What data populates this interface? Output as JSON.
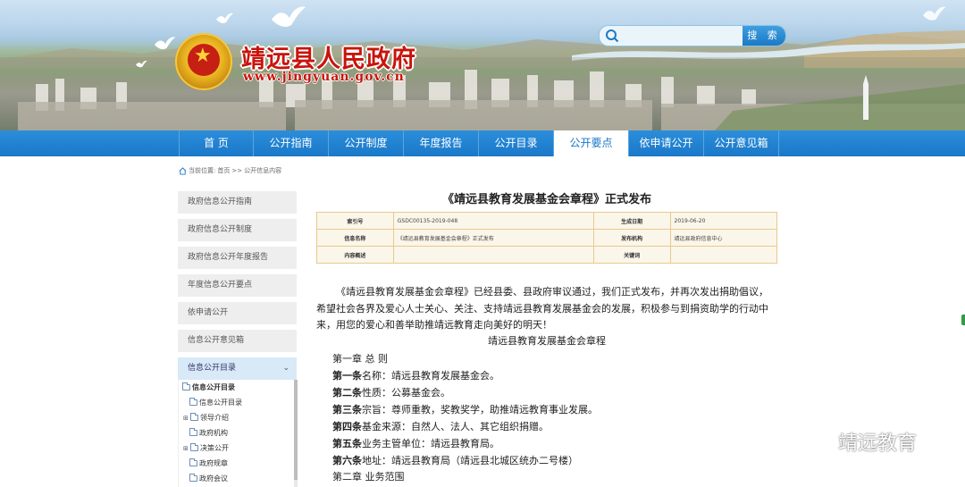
{
  "header": {
    "site_title": "靖远县人民政府",
    "site_url": "www.jingyuan.gov.cn",
    "search": {
      "placeholder": "",
      "button_label": "搜 索"
    }
  },
  "nav": {
    "items": [
      "首 页",
      "公开指南",
      "公开制度",
      "年度报告",
      "公开目录",
      "公开要点",
      "依申请公开",
      "公开意见箱"
    ],
    "active_index": 5
  },
  "breadcrumb": {
    "prefix": "当前位置:",
    "home": "首页",
    "sep": ">>",
    "current": "公开信息内容"
  },
  "sidebar": {
    "items": [
      "政府信息公开指南",
      "政府信息公开制度",
      "政府信息公开年度报告",
      "年度信息公开要点",
      "依申请公开",
      "信息公开意见箱"
    ],
    "directory_label": "信息公开目录",
    "tree": {
      "root": "信息公开目录",
      "nodes": [
        "信息公开目录",
        "领导介绍",
        "政府机构",
        "决策公开",
        "政府规章",
        "政府会议"
      ]
    }
  },
  "article": {
    "title": "《靖远县教育发展基金会章程》正式发布",
    "meta": {
      "index_label": "索引号",
      "index_value": "GSDC00135-2019-048",
      "date_label": "生成日期",
      "date_value": "2019-06-20",
      "name_label": "信息名称",
      "name_value": "《靖远县教育发展基金会章程》正式发布",
      "org_label": "发布机构",
      "org_value": "靖远县政府信息中心",
      "summary_label": "内容概述",
      "summary_value": "",
      "keyword_label": "关键词",
      "keyword_value": ""
    },
    "intro": "《靖远县教育发展基金会章程》已经县委、县政府审议通过，我们正式发布，并再次发出捐助倡议，希望社会各界及爱心人士关心、关注、支持靖远县教育发展基金会的发展，积极参与到捐资助学的行动中来，用您的爱心和善举助推靖远教育走向美好的明天！",
    "subtitle": "靖远县教育发展基金会章程",
    "chapter1": "第一章 总 则",
    "articles": [
      {
        "label": "第一条",
        "text": "名称：靖远县教育发展基金会。"
      },
      {
        "label": "第二条",
        "text": "性质：公募基金会。"
      },
      {
        "label": "第三条",
        "text": "宗旨：尊师重教，奖教奖学，助推靖远教育事业发展。"
      },
      {
        "label": "第四条",
        "text": "基金来源：自然人、法人、其它组织捐赠。"
      },
      {
        "label": "第五条",
        "text": "业务主管单位：靖远县教育局。"
      },
      {
        "label": "第六条",
        "text": "地址：靖远县教育局（靖远县北城区统办二号楼）"
      }
    ],
    "chapter2": "第二章 业务范围"
  },
  "watermark": {
    "text": "靖远教育"
  },
  "colors": {
    "nav_blue": "#1a78c8",
    "title_red": "#c8140c",
    "table_border": "#e8c98f"
  }
}
